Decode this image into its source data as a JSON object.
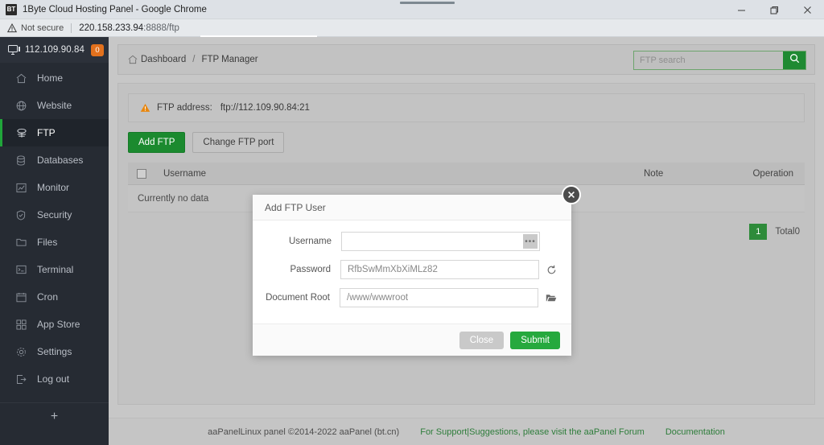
{
  "window": {
    "favicon_label": "BT",
    "title": "1Byte Cloud Hosting Panel - Google Chrome",
    "minimize_icon": "minimize-icon",
    "restore_icon": "restore-icon",
    "close_icon": "close-icon"
  },
  "omnibox": {
    "warning_icon": "not-secure-warning-icon",
    "security_text": "Not secure",
    "url_host": "220.158.233.94",
    "url_rest": ":8888/ftp"
  },
  "sidebar": {
    "server_icon": "monitor-icon",
    "server_ip": "112.109.90.84",
    "badge_count": "0",
    "items": [
      {
        "label": "Home",
        "icon": "home-icon",
        "active": false
      },
      {
        "label": "Website",
        "icon": "globe-icon",
        "active": false
      },
      {
        "label": "FTP",
        "icon": "ftp-icon",
        "active": true
      },
      {
        "label": "Databases",
        "icon": "database-icon",
        "active": false
      },
      {
        "label": "Monitor",
        "icon": "chart-icon",
        "active": false
      },
      {
        "label": "Security",
        "icon": "shield-icon",
        "active": false
      },
      {
        "label": "Files",
        "icon": "folder-icon",
        "active": false
      },
      {
        "label": "Terminal",
        "icon": "terminal-icon",
        "active": false
      },
      {
        "label": "Cron",
        "icon": "calendar-icon",
        "active": false
      },
      {
        "label": "App Store",
        "icon": "grid-icon",
        "active": false
      },
      {
        "label": "Settings",
        "icon": "gear-icon",
        "active": false
      },
      {
        "label": "Log out",
        "icon": "logout-icon",
        "active": false
      }
    ],
    "add_label": "+"
  },
  "topbar": {
    "home_icon": "home-icon",
    "breadcrumb_root": "Dashboard",
    "breadcrumb_sep": "/",
    "breadcrumb_current": "FTP Manager",
    "search_placeholder": "FTP search",
    "search_value": "",
    "search_icon": "search-icon"
  },
  "notice": {
    "warn_icon": "warning-triangle-icon",
    "label": "FTP address:",
    "value": "ftp://112.109.90.84:21"
  },
  "actions": {
    "add_ftp": "Add FTP",
    "change_port": "Change FTP port"
  },
  "table": {
    "columns": {
      "username": "Username",
      "password": "",
      "note": "Note",
      "operation": "Operation"
    },
    "empty_text": "Currently no data"
  },
  "pager": {
    "current_page": "1",
    "total_label": "Total0"
  },
  "footer": {
    "copyright": "aaPanelLinux panel ©2014-2022 aaPanel (bt.cn)",
    "support": "For Support|Suggestions, please visit the aaPanel Forum",
    "documentation": "Documentation"
  },
  "modal": {
    "title": "Add FTP User",
    "close_icon": "close-icon",
    "fields": {
      "username": {
        "label": "Username",
        "value": "",
        "placeholder": "",
        "suffix_icon": "ellipsis-button-icon",
        "suffix_label": "•••"
      },
      "password": {
        "label": "Password",
        "value": "RfbSwMmXbXiMLz82",
        "suffix_icon": "refresh-icon"
      },
      "document_root": {
        "label": "Document Root",
        "value": "/www/wwwroot",
        "suffix_icon": "folder-open-icon"
      }
    },
    "buttons": {
      "close": "Close",
      "submit": "Submit"
    },
    "colors": {
      "submit_green": "#26a93e",
      "close_gray": "#c9c9c9"
    }
  },
  "colors": {
    "sidebar_bg": "#262b33",
    "accent_green": "#1b8a2f",
    "badge_orange": "#e2711d"
  }
}
